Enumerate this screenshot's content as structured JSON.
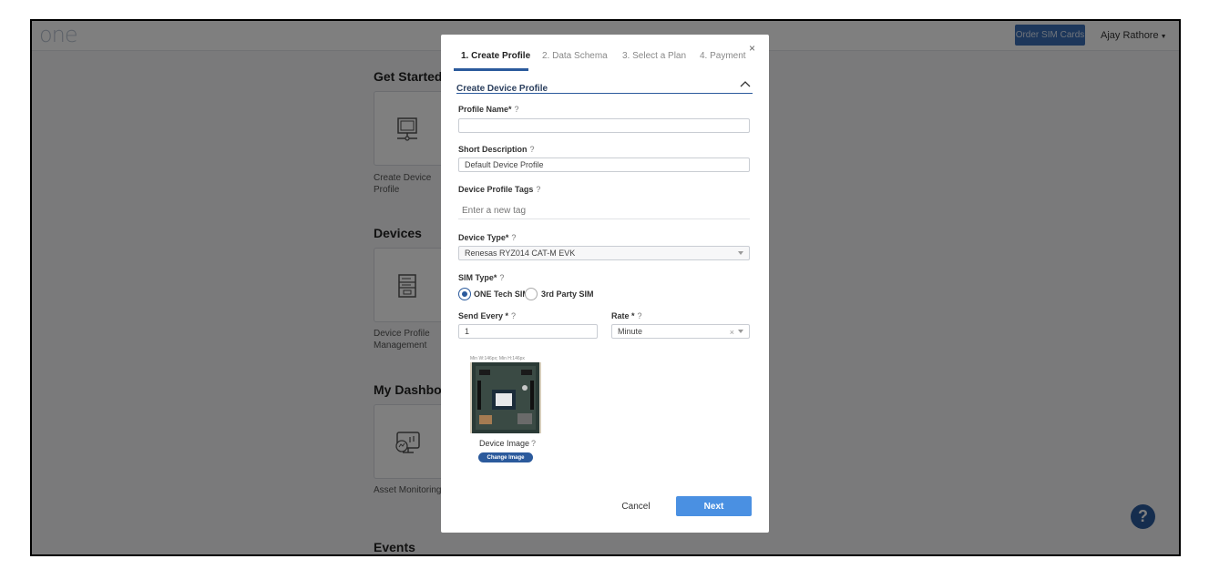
{
  "app": {
    "logo_text": "one",
    "order_button": "Order SIM Cards",
    "user_name": "Ajay Rathore",
    "sections": [
      {
        "title": "Get Started",
        "card_label": "Create Device\nProfile",
        "icon": "monitor-network-icon"
      },
      {
        "title": "Devices",
        "card_label": "Device Profile\nManagement",
        "icon": "filing-cabinet-icon"
      },
      {
        "title": "My Dashboard",
        "card_label": "Asset Monitoring",
        "icon": "monitoring-dashboard-icon"
      },
      {
        "title": "Events"
      }
    ],
    "help_label": "?"
  },
  "modal": {
    "tabs": [
      "1. Create Profile",
      "2. Data Schema",
      "3. Select a Plan",
      "4. Payment"
    ],
    "active_tab": 0,
    "close_label": "×",
    "section_title": "Create Device Profile",
    "fields": {
      "profile_name": {
        "label": "Profile Name*",
        "value": ""
      },
      "short_description": {
        "label": "Short Description",
        "value": "Default Device Profile"
      },
      "tags": {
        "label": "Device Profile Tags",
        "placeholder": "Enter a new tag"
      },
      "device_type": {
        "label": "Device Type*",
        "value": "Renesas RYZ014 CAT-M EVK"
      },
      "sim_type": {
        "label": "SIM Type*",
        "options": [
          "ONE Tech SIM",
          "3rd Party SIM"
        ],
        "selected": "ONE Tech SIM"
      },
      "send_every": {
        "label": "Send Every *",
        "value": "1"
      },
      "rate": {
        "label": "Rate *",
        "value": "Minute",
        "clear": "×"
      }
    },
    "image": {
      "note": "Min W:146px; Min H:146px",
      "label": "Device Image",
      "change_button": "Change Image"
    },
    "help_glyph": "?",
    "cancel_label": "Cancel",
    "next_label": "Next"
  },
  "colors": {
    "primary": "#2b5a9c",
    "next_button": "#4a90e2",
    "overlay": "rgba(0,0,0,0.5)"
  }
}
